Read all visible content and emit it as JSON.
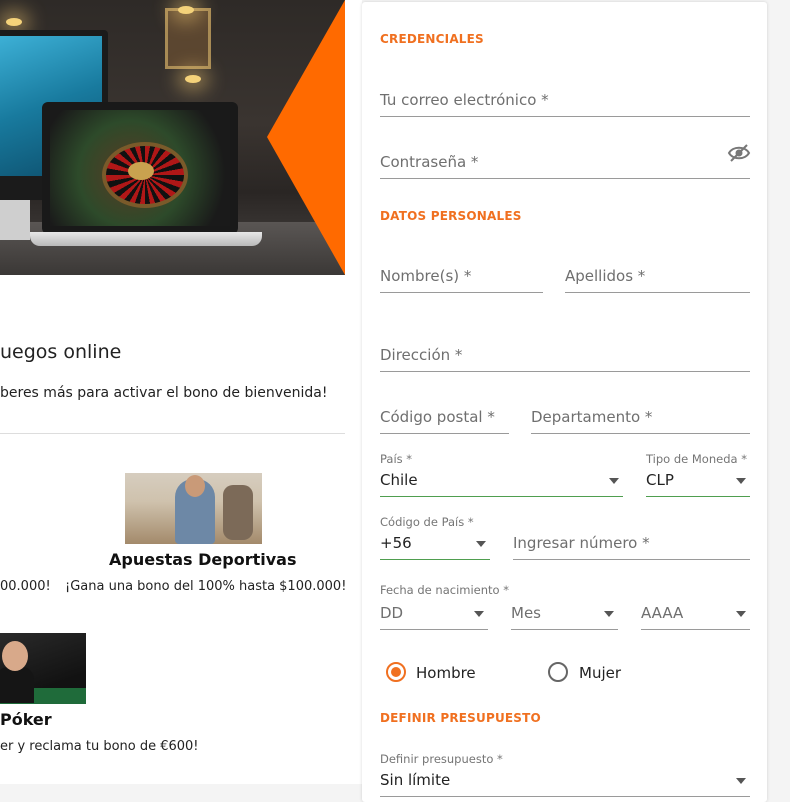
{
  "left": {
    "promo_title": "uegos online",
    "promo_subtitle": "beres más para activar el bono de bienvenida!",
    "sports": {
      "title": "Apuestas Deportivas",
      "text": "¡Gana una bono del 100% hasta $100.000!",
      "text_left": "00.000!"
    },
    "poker": {
      "title": "Póker",
      "text": "er y reclama tu bono de €600!"
    }
  },
  "form": {
    "credentials_title": "CREDENCIALES",
    "email_placeholder": "Tu correo electrónico *",
    "password_placeholder": "Contraseña *",
    "personal_title": "DATOS PERSONALES",
    "first_name_placeholder": "Nombre(s) *",
    "last_name_placeholder": "Apellidos *",
    "address_placeholder": "Dirección *",
    "postal_code_placeholder": "Código postal *",
    "department_placeholder": "Departamento *",
    "country_label": "País *",
    "country_value": "Chile",
    "currency_label": "Tipo de Moneda *",
    "currency_value": "CLP",
    "country_code_label": "Código de País *",
    "country_code_value": "+56",
    "phone_placeholder": "Ingresar número *",
    "birthdate_label": "Fecha de nacimiento *",
    "day_placeholder": "DD",
    "month_placeholder": "Mes",
    "year_placeholder": "AAAA",
    "gender_male": "Hombre",
    "gender_female": "Mujer",
    "selected_gender": "Hombre",
    "budget_title": "DEFINIR PRESUPUESTO",
    "budget_label": "Definir presupuesto *",
    "budget_value": "Sin límite"
  },
  "colors": {
    "accent": "#f07020",
    "valid_underline": "#4f9e4f"
  }
}
